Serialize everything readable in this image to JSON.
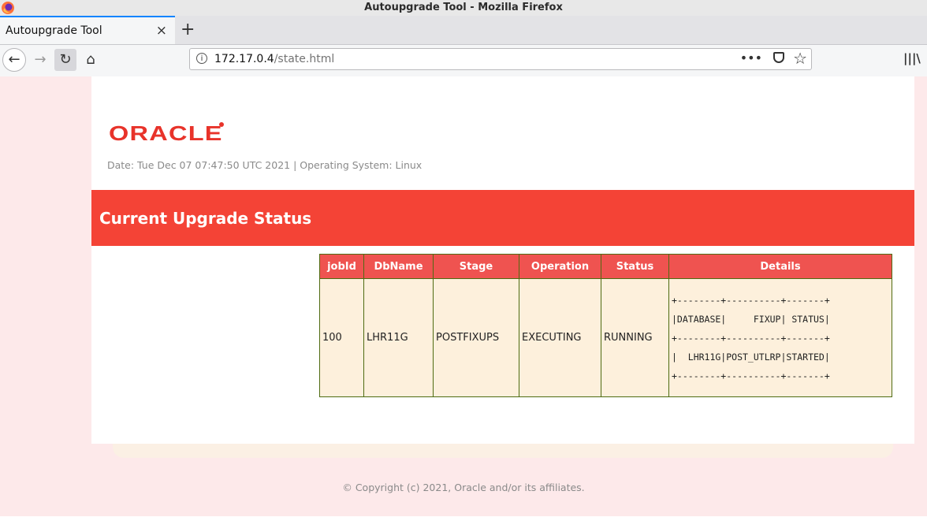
{
  "window": {
    "title": "Autoupgrade Tool - Mozilla Firefox"
  },
  "tab": {
    "title": "Autoupgrade Tool",
    "close_glyph": "×",
    "new_tab_glyph": "+"
  },
  "nav": {
    "back_icon": "back-arrow-icon",
    "forward_icon": "forward-arrow-icon",
    "reload_icon": "reload-icon",
    "home_icon": "home-icon",
    "back_glyph": "←",
    "forward_glyph": "→",
    "reload_glyph": "↻",
    "home_glyph": "⌂"
  },
  "url": {
    "host": "172.17.0.4",
    "path": "/state.html",
    "more_glyph": "•••",
    "star_glyph": "☆"
  },
  "toolbar": {
    "library_glyph": "|||\\"
  },
  "page": {
    "logo_text": "ORACLE",
    "dateline": "Date: Tue Dec 07 07:47:50 UTC 2021 | Operating System: Linux",
    "banner_title": "Current Upgrade Status",
    "copyright": "© Copyright (c) 2021, Oracle and/or its affiliates."
  },
  "table": {
    "headers": [
      "jobId",
      "DbName",
      "Stage",
      "Operation",
      "Status",
      "Details"
    ],
    "row": {
      "jobId": "100",
      "dbname": "LHR11G",
      "stage": "POSTFIXUPS",
      "operation": "EXECUTING",
      "status": "RUNNING",
      "details": [
        "+--------+----------+-------+",
        "|DATABASE|     FIXUP| STATUS|",
        "+--------+----------+-------+",
        "|  LHR11G|POST_UTLRP|STARTED|",
        "+--------+----------+-------+"
      ]
    }
  },
  "colors": {
    "brand_red": "#e8332a",
    "banner": "#f44336",
    "table_header": "#ef5350",
    "cell_bg": "#fdf0dc",
    "page_bg": "#fde9ea"
  }
}
